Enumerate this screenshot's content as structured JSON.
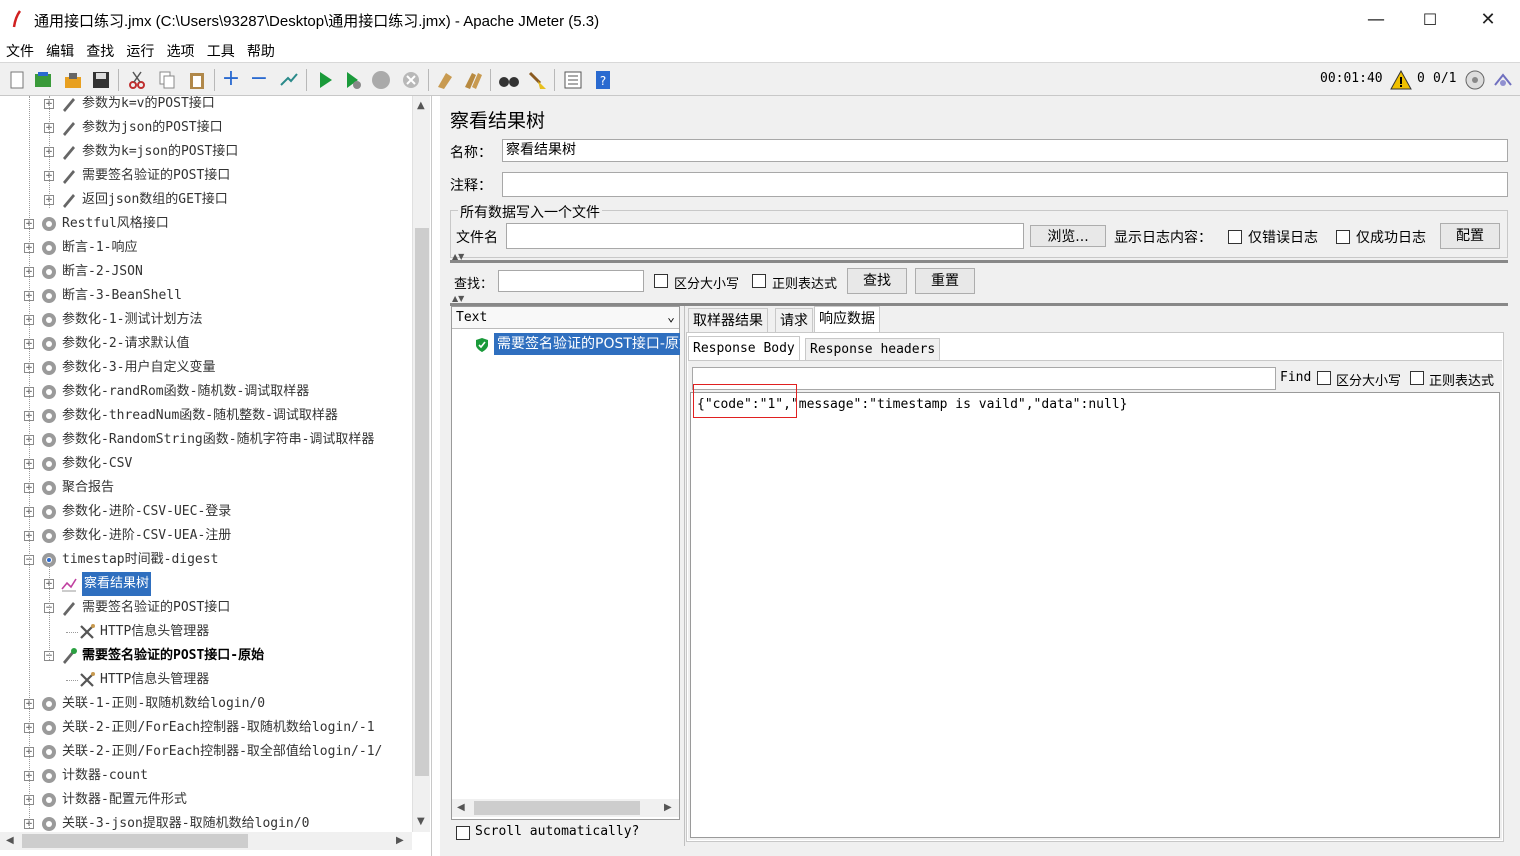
{
  "window": {
    "title": "通用接口练习.jmx (C:\\Users\\93287\\Desktop\\通用接口练习.jmx) - Apache JMeter (5.3)",
    "minimize": "—",
    "maximize": "☐",
    "close": "✕"
  },
  "menu": [
    "文件",
    "编辑",
    "查找",
    "运行",
    "选项",
    "工具",
    "帮助"
  ],
  "toolbar": {
    "elapsed": "00:01:40",
    "warnings": "0",
    "threads": "0/1"
  },
  "tree": {
    "items": [
      {
        "label": "参数为k=v的POST接口",
        "level": 2,
        "icon": "pencil-icon"
      },
      {
        "label": "参数为json的POST接口",
        "level": 2,
        "icon": "pencil-icon"
      },
      {
        "label": "参数为k=json的POST接口",
        "level": 2,
        "icon": "pencil-icon"
      },
      {
        "label": "需要签名验证的POST接口",
        "level": 2,
        "icon": "pencil-icon"
      },
      {
        "label": "返回json数组的GET接口",
        "level": 2,
        "icon": "pencil-icon"
      },
      {
        "label": "Restful风格接口",
        "level": 1,
        "icon": "gear-icon"
      },
      {
        "label": "断言-1-响应",
        "level": 1,
        "icon": "gear-icon"
      },
      {
        "label": "断言-2-JSON",
        "level": 1,
        "icon": "gear-icon"
      },
      {
        "label": "断言-3-BeanShell",
        "level": 1,
        "icon": "gear-icon"
      },
      {
        "label": "参数化-1-测试计划方法",
        "level": 1,
        "icon": "gear-icon"
      },
      {
        "label": "参数化-2-请求默认值",
        "level": 1,
        "icon": "gear-icon"
      },
      {
        "label": "参数化-3-用户自定义变量",
        "level": 1,
        "icon": "gear-icon"
      },
      {
        "label": "参数化-randRom函数-随机数-调试取样器",
        "level": 1,
        "icon": "gear-icon"
      },
      {
        "label": "参数化-threadNum函数-随机整数-调试取样器",
        "level": 1,
        "icon": "gear-icon"
      },
      {
        "label": "参数化-RandomString函数-随机字符串-调试取样器",
        "level": 1,
        "icon": "gear-icon"
      },
      {
        "label": "参数化-CSV",
        "level": 1,
        "icon": "gear-icon"
      },
      {
        "label": "聚合报告",
        "level": 1,
        "icon": "gear-icon"
      },
      {
        "label": "参数化-进阶-CSV-UEC-登录",
        "level": 1,
        "icon": "gear-icon"
      },
      {
        "label": "参数化-进阶-CSV-UEA-注册",
        "level": 1,
        "icon": "gear-icon"
      },
      {
        "label": "timestap时间戳-digest",
        "level": 1,
        "icon": "gear-running-icon",
        "expanded": true
      },
      {
        "label": "察看结果树",
        "level": 2,
        "icon": "chart-icon",
        "selected": true
      },
      {
        "label": "需要签名验证的POST接口",
        "level": 2,
        "icon": "pencil-icon",
        "expanded": true
      },
      {
        "label": "HTTP信息头管理器",
        "level": 3,
        "icon": "tools-icon"
      },
      {
        "label": "需要签名验证的POST接口-原始",
        "level": 2,
        "icon": "pencil-green-icon",
        "expanded": true,
        "bold": true
      },
      {
        "label": "HTTP信息头管理器",
        "level": 3,
        "icon": "tools-icon"
      },
      {
        "label": "关联-1-正则-取随机数给login/0",
        "level": 1,
        "icon": "gear-icon"
      },
      {
        "label": "关联-2-正则/ForEach控制器-取随机数给login/-1",
        "level": 1,
        "icon": "gear-icon"
      },
      {
        "label": "关联-2-正则/ForEach控制器-取全部值给login/-1/",
        "level": 1,
        "icon": "gear-icon"
      },
      {
        "label": "计数器-count",
        "level": 1,
        "icon": "gear-icon"
      },
      {
        "label": "计数器-配置元件形式",
        "level": 1,
        "icon": "gear-icon"
      },
      {
        "label": "关联-3-json提取器-取随机数给login/0",
        "level": 1,
        "icon": "gear-icon"
      }
    ]
  },
  "panel": {
    "title": "察看结果树",
    "name_label": "名称：",
    "name_value": "察看结果树",
    "comment_label": "注释：",
    "comment_value": "",
    "file_section": "所有数据写入一个文件",
    "filename_label": "文件名",
    "filename_value": "",
    "browse_button": "浏览...",
    "log_label": "显示日志内容：",
    "errors_only": "仅错误日志",
    "success_only": "仅成功日志",
    "config_button": "配置",
    "search_label": "查找：",
    "search_value": "",
    "case_sensitive": "区分大小写",
    "regex": "正则表达式",
    "search_button": "查找",
    "reset_button": "重置"
  },
  "renderer": {
    "selected": "Text",
    "result": "需要签名验证的POST接口-原始",
    "scroll_auto": "Scroll automatically?"
  },
  "result_tabs": [
    "取样器结果",
    "请求",
    "响应数据"
  ],
  "response_tabs": [
    "Response Body",
    "Response headers"
  ],
  "response": {
    "find_label": "Find",
    "case_sensitive": "区分大小写",
    "regex": "正则表达式",
    "body": "{\"code\":\"1\",\"message\":\"timestamp is vaild\",\"data\":null}"
  }
}
